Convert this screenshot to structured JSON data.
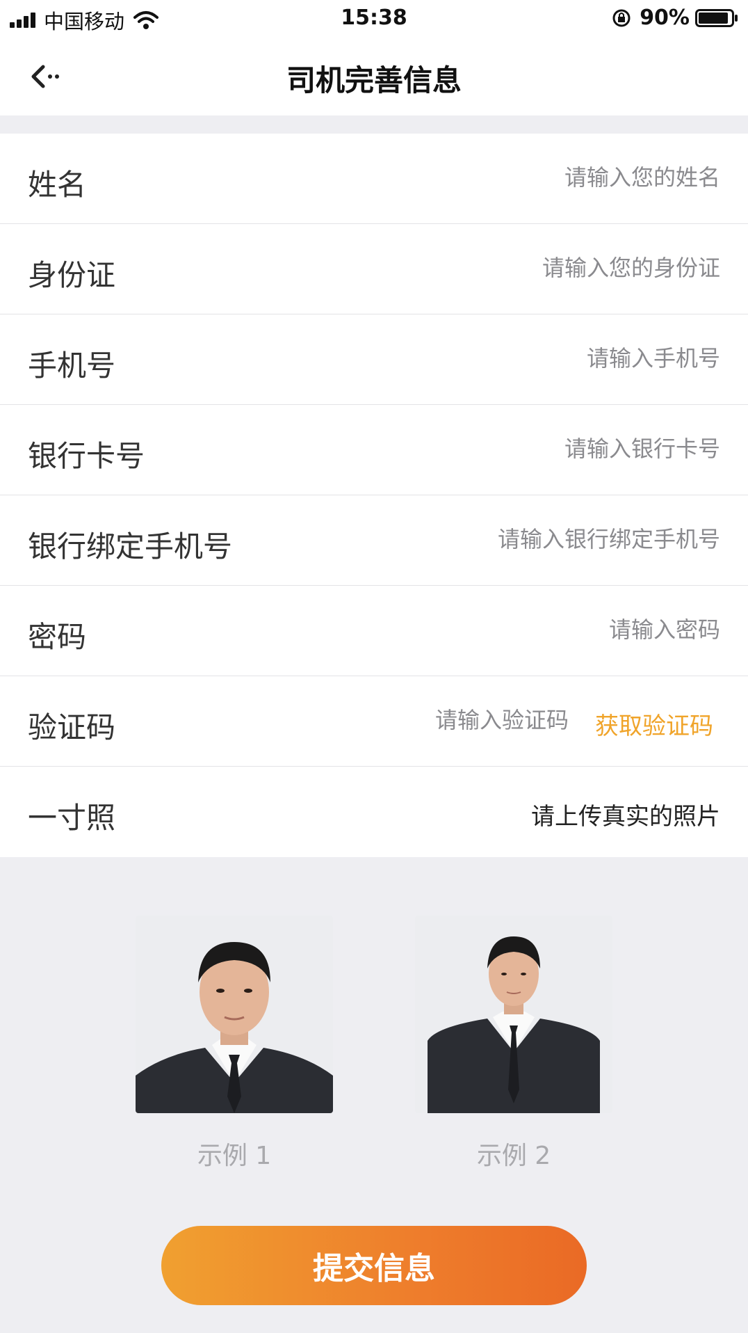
{
  "status_bar": {
    "carrier": "中国移动",
    "time": "15:38",
    "battery": "90%"
  },
  "header": {
    "title": "司机完善信息"
  },
  "form": {
    "name": {
      "label": "姓名",
      "placeholder": "请输入您的姓名"
    },
    "id_card": {
      "label": "身份证",
      "placeholder": "请输入您的身份证"
    },
    "phone": {
      "label": "手机号",
      "placeholder": "请输入手机号"
    },
    "bank_card": {
      "label": "银行卡号",
      "placeholder": "请输入银行卡号"
    },
    "bank_phone": {
      "label": "银行绑定手机号",
      "placeholder": "请输入银行绑定手机号"
    },
    "password": {
      "label": "密码",
      "placeholder": "请输入密码"
    },
    "verify_code": {
      "label": "验证码",
      "placeholder": "请输入验证码",
      "action": "获取验证码"
    },
    "photo": {
      "label": "一寸照",
      "hint": "请上传真实的照片"
    }
  },
  "samples": [
    {
      "caption": "示例 1"
    },
    {
      "caption": "示例 2"
    }
  ],
  "submit_label": "提交信息",
  "colors": {
    "accent": "#f0a42a",
    "button_start": "#f0a030",
    "button_end": "#ea6a25"
  }
}
